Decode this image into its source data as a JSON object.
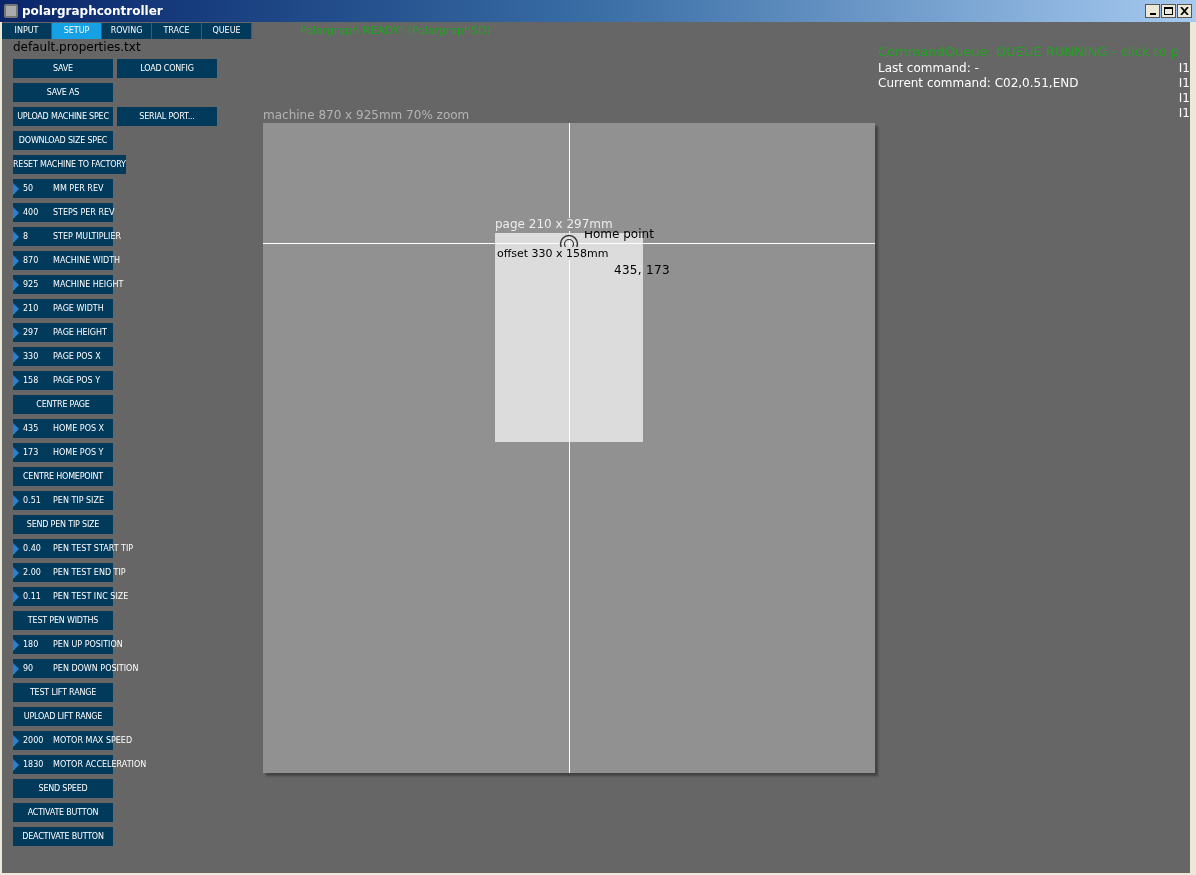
{
  "window": {
    "title": "polargraphcontroller"
  },
  "tabs": [
    {
      "label": "INPUT",
      "selected": false
    },
    {
      "label": "SETUP",
      "selected": true
    },
    {
      "label": "ROVING",
      "selected": false
    },
    {
      "label": "TRACE",
      "selected": false
    },
    {
      "label": "QUEUE",
      "selected": false
    }
  ],
  "status": "Polargraph READY! (PolargraphSD)",
  "properties_file": "default.properties.txt",
  "controls": [
    {
      "kind": "button",
      "label": "SAVE",
      "second": "LOAD CONFIG"
    },
    {
      "kind": "button",
      "label": "SAVE AS"
    },
    {
      "kind": "button",
      "label": "UPLOAD MACHINE SPEC",
      "second": "SERIAL PORT..."
    },
    {
      "kind": "button",
      "label": "DOWNLOAD SIZE SPEC"
    },
    {
      "kind": "button",
      "label": "RESET MACHINE TO FACTORY"
    },
    {
      "kind": "number",
      "value": "50",
      "label": "MM PER REV"
    },
    {
      "kind": "number",
      "value": "400",
      "label": "STEPS PER REV"
    },
    {
      "kind": "number",
      "value": "8",
      "label": "STEP MULTIPLIER"
    },
    {
      "kind": "number",
      "value": "870",
      "label": "MACHINE WIDTH"
    },
    {
      "kind": "number",
      "value": "925",
      "label": "MACHINE HEIGHT"
    },
    {
      "kind": "number",
      "value": "210",
      "label": "PAGE WIDTH"
    },
    {
      "kind": "number",
      "value": "297",
      "label": "PAGE HEIGHT"
    },
    {
      "kind": "number",
      "value": "330",
      "label": "PAGE POS X"
    },
    {
      "kind": "number",
      "value": "158",
      "label": "PAGE POS Y"
    },
    {
      "kind": "button",
      "label": "CENTRE PAGE"
    },
    {
      "kind": "number",
      "value": "435",
      "label": "HOME POS X"
    },
    {
      "kind": "number",
      "value": "173",
      "label": "HOME POS Y"
    },
    {
      "kind": "button",
      "label": "CENTRE HOMEPOINT"
    },
    {
      "kind": "number",
      "value": "0.51",
      "label": "PEN TIP SIZE"
    },
    {
      "kind": "button",
      "label": "SEND PEN TIP SIZE"
    },
    {
      "kind": "number",
      "value": "0.40",
      "label": "PEN TEST START TIP"
    },
    {
      "kind": "number",
      "value": "2.00",
      "label": "PEN TEST END TIP"
    },
    {
      "kind": "number",
      "value": "0.11",
      "label": "PEN TEST INC SIZE"
    },
    {
      "kind": "button",
      "label": "TEST PEN WIDTHS"
    },
    {
      "kind": "number",
      "value": "180",
      "label": "PEN UP POSITION"
    },
    {
      "kind": "number",
      "value": "90",
      "label": "PEN DOWN POSITION"
    },
    {
      "kind": "button",
      "label": "TEST LIFT RANGE"
    },
    {
      "kind": "button",
      "label": "UPLOAD LIFT RANGE"
    },
    {
      "kind": "number",
      "value": "2000",
      "label": "MOTOR MAX SPEED"
    },
    {
      "kind": "number",
      "value": "1830",
      "label": "MOTOR ACCELERATION"
    },
    {
      "kind": "button",
      "label": "SEND SPEED"
    },
    {
      "kind": "button",
      "label": "ACTIVATE BUTTON"
    },
    {
      "kind": "button",
      "label": "DEACTIVATE BUTTON"
    }
  ],
  "canvas": {
    "machine_label": "machine 870 x 925mm 70% zoom",
    "page_label": "page 210 x 297mm",
    "offset_label": "offset 330 x 158mm",
    "home_label": "Home point",
    "home_coords": "435, 173"
  },
  "queue": {
    "status": "CommandQueue: QUEUE RUNNING - click to p",
    "last_command": "Last command: -",
    "current_command": "Current command: C02,0.51,END"
  },
  "side_column": [
    "I1",
    "I1",
    "I1",
    "I1"
  ]
}
